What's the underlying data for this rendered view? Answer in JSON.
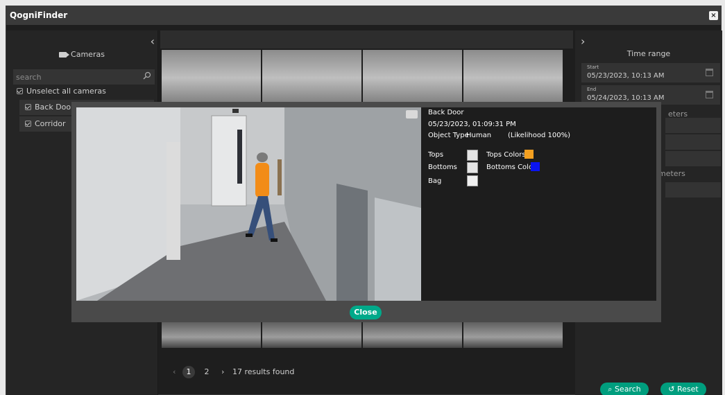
{
  "window": {
    "title": "QogniFinder",
    "close_label": "×"
  },
  "left_panel": {
    "cameras_title": "Cameras",
    "search_placeholder": "search",
    "unselect_all_label": "Unselect all cameras",
    "cameras": [
      {
        "label": "Back Door"
      },
      {
        "label": "Corridor"
      }
    ]
  },
  "pagination": {
    "pages": [
      "1",
      "2"
    ],
    "active_page": "1",
    "results_text": "17 results found"
  },
  "right_panel": {
    "time_range_title": "Time range",
    "start_label": "Start",
    "start_value": "05/23/2023, 10:13 AM",
    "end_label": "End",
    "end_value": "05/24/2023, 10:13 AM",
    "peek_label_1": "eters",
    "peek_label_2": "meters",
    "search_button": "Search",
    "reset_button": "Reset"
  },
  "modal": {
    "camera_name": "Back Door",
    "timestamp": "05/23/2023, 01:09:31 PM",
    "object_type_label": "Object Type",
    "object_type_value": "Human",
    "likelihood": "(Likelihood 100%)",
    "tops_label": "Tops",
    "tops_colors_label": "Tops Colors",
    "tops_color": "#f4a020",
    "bottoms_label": "Bottoms",
    "bottoms_color_label": "Bottoms Color",
    "bottoms_color": "#0a14f0",
    "bag_label": "Bag",
    "close_button": "Close"
  },
  "colors": {
    "accent": "#00a98a"
  }
}
